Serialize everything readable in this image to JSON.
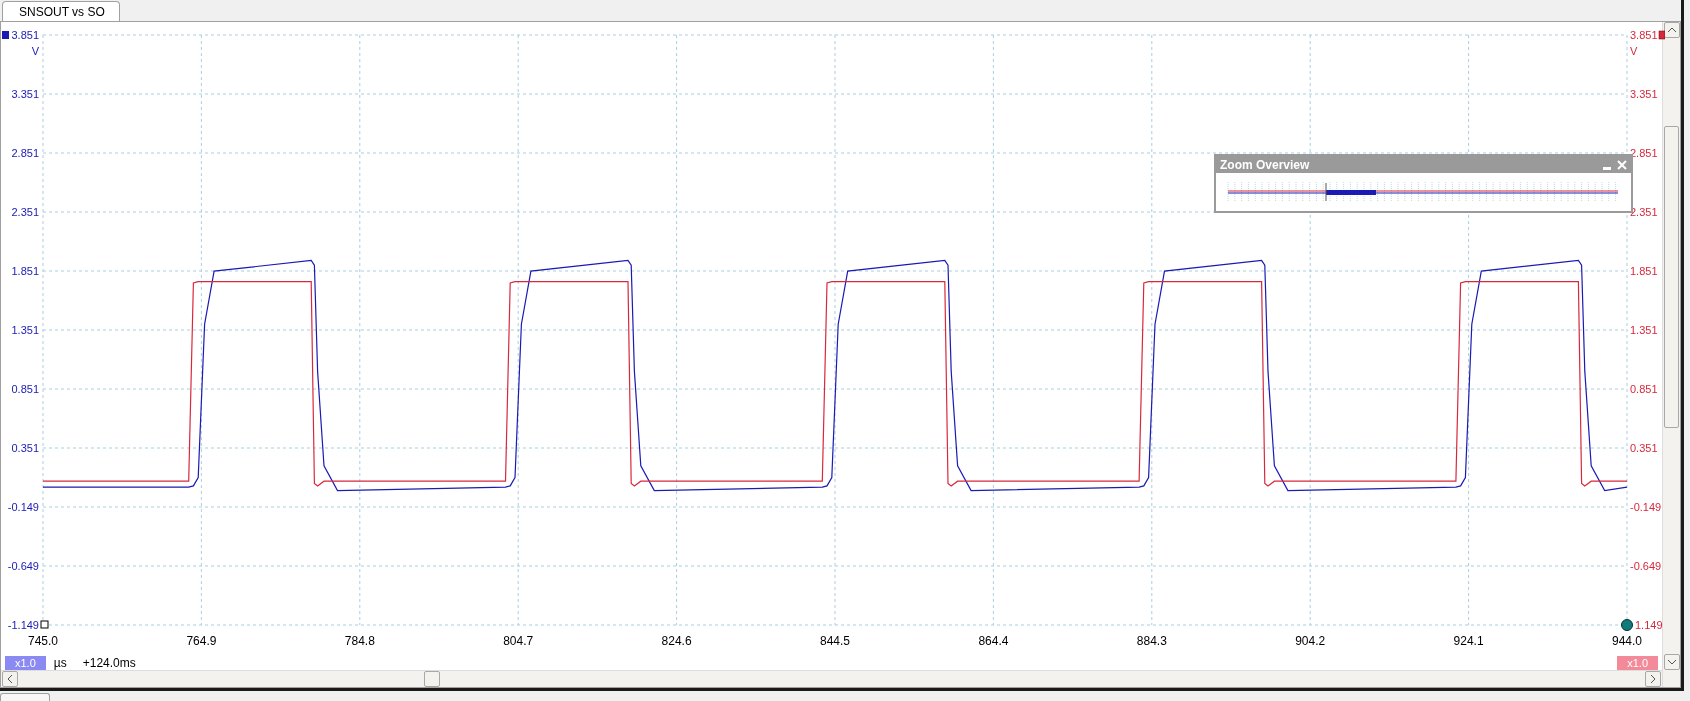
{
  "tabs": [
    {
      "label": "SNSOUT vs SO",
      "selected": true
    }
  ],
  "plot": {
    "left_unit": "V",
    "right_unit": "V",
    "right_axis_labels": [
      "3.851",
      "3.351",
      "2.851",
      "2.351",
      "1.851",
      "1.351",
      "0.851",
      "0.351",
      "-0.149",
      "-0.649",
      "1.149"
    ],
    "chart_data": {
      "type": "line",
      "grid": true,
      "xlim": [
        745.0,
        944.0
      ],
      "ylim": [
        -1.149,
        3.851
      ],
      "xticks": [
        {
          "value": 745.0,
          "label": "745.0"
        },
        {
          "value": 764.9,
          "label": "764.9"
        },
        {
          "value": 784.8,
          "label": "784.8"
        },
        {
          "value": 804.7,
          "label": "804.7"
        },
        {
          "value": 824.6,
          "label": "824.6"
        },
        {
          "value": 844.5,
          "label": "844.5"
        },
        {
          "value": 864.4,
          "label": "864.4"
        },
        {
          "value": 884.3,
          "label": "884.3"
        },
        {
          "value": 904.2,
          "label": "904.2"
        },
        {
          "value": 924.1,
          "label": "924.1"
        },
        {
          "value": 944.0,
          "label": "944.0"
        }
      ],
      "yticks": [
        3.851,
        3.351,
        2.851,
        2.351,
        1.851,
        1.351,
        0.851,
        0.351,
        -0.149,
        -0.649,
        -1.149
      ],
      "x": [
        745.0,
        763.3,
        763.9,
        764.5,
        765.3,
        766.5,
        778.7,
        779.1,
        779.5,
        780.3,
        782.0,
        803.1,
        803.7,
        804.3,
        805.1,
        806.3,
        818.5,
        818.9,
        819.3,
        820.1,
        821.8,
        842.9,
        843.5,
        844.1,
        844.9,
        846.1,
        858.3,
        858.7,
        859.1,
        859.9,
        861.6,
        882.7,
        883.3,
        883.9,
        884.7,
        885.9,
        898.1,
        898.5,
        898.9,
        899.7,
        901.4,
        922.5,
        923.1,
        923.7,
        924.5,
        925.7,
        937.9,
        938.3,
        938.7,
        939.5,
        941.2,
        944.0
      ],
      "series": [
        {
          "color": "#1a1ab4",
          "values": [
            0.02,
            0.02,
            0.03,
            0.1,
            1.4,
            1.85,
            1.94,
            1.9,
            1.0,
            0.2,
            -0.01,
            0.02,
            0.03,
            0.1,
            1.4,
            1.85,
            1.94,
            1.9,
            1.0,
            0.2,
            -0.01,
            0.02,
            0.03,
            0.1,
            1.4,
            1.85,
            1.94,
            1.9,
            1.0,
            0.2,
            -0.01,
            0.02,
            0.03,
            0.1,
            1.4,
            1.85,
            1.94,
            1.9,
            1.0,
            0.2,
            -0.01,
            0.02,
            0.03,
            0.1,
            1.4,
            1.85,
            1.94,
            1.9,
            1.0,
            0.2,
            -0.01,
            0.02
          ]
        },
        {
          "color": "#d8283c",
          "values": [
            0.07,
            0.07,
            1.75,
            1.76,
            1.76,
            1.76,
            1.76,
            0.05,
            0.03,
            0.07,
            0.07,
            0.07,
            1.75,
            1.76,
            1.76,
            1.76,
            1.76,
            0.05,
            0.03,
            0.07,
            0.07,
            0.07,
            1.75,
            1.76,
            1.76,
            1.76,
            1.76,
            0.05,
            0.03,
            0.07,
            0.07,
            0.07,
            1.75,
            1.76,
            1.76,
            1.76,
            1.76,
            0.05,
            0.03,
            0.07,
            0.07,
            0.07,
            1.75,
            1.76,
            1.76,
            1.76,
            1.76,
            0.05,
            0.03,
            0.07,
            0.07,
            0.07
          ]
        }
      ]
    }
  },
  "zoom_overview": {
    "title": "Zoom Overview"
  },
  "footer": {
    "left_scale": "x1.0",
    "unit": "µs",
    "offset": "+124.0ms",
    "right_scale": "x1.0"
  }
}
